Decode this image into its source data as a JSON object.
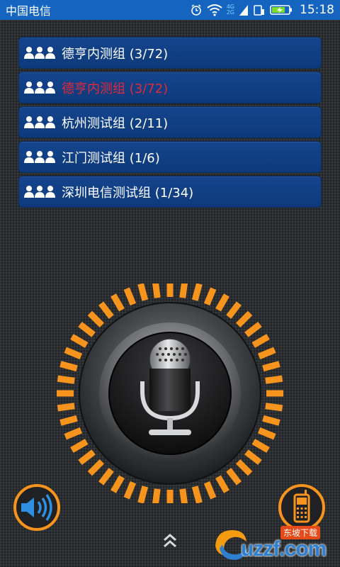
{
  "status_bar": {
    "carrier": "中国电信",
    "network_small": "4G",
    "network_small2": "2G",
    "time": "15:18",
    "icons": [
      "alarm-icon",
      "wifi-icon",
      "signal-icon",
      "sim-icon",
      "battery-icon"
    ]
  },
  "groups": [
    {
      "label": "德亨内测组 (3/72)",
      "active": false
    },
    {
      "label": "德亨内测组 (3/72)",
      "active": true
    },
    {
      "label": "杭州测试组 (2/11)",
      "active": false
    },
    {
      "label": "江门测试组 (1/6)",
      "active": false
    },
    {
      "label": "深圳电信测试组 (1/34)",
      "active": false
    }
  ],
  "colors": {
    "status_bar": "#1565c0",
    "group_bg": "#14448d",
    "active_label": "#e0293a",
    "ring_orange": "#f7941d"
  },
  "controls": {
    "talk_button_icon": "microphone-icon",
    "left_button_icon": "speaker-icon",
    "right_button_icon": "mobile-phone-icon",
    "bottom_handle_icon": "double-chevron-up-icon"
  },
  "watermark": {
    "text": "uzzf.com",
    "badge": "东坡下载"
  }
}
